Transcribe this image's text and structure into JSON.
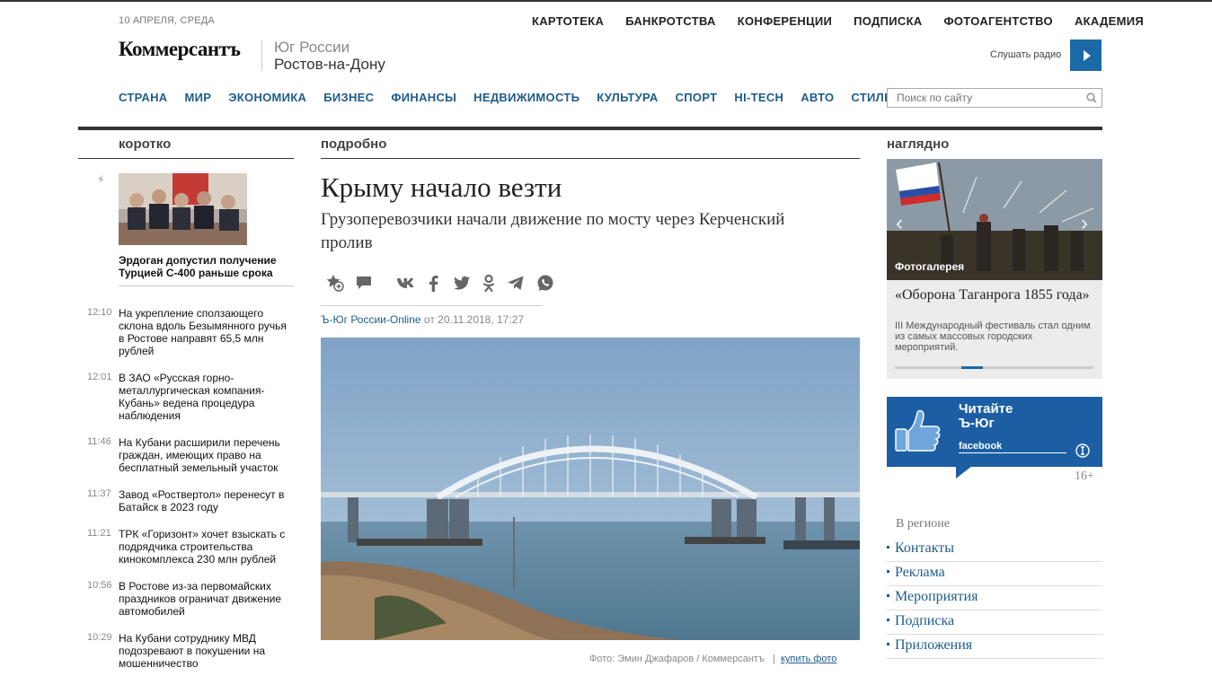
{
  "header": {
    "date": "10 АПРЕЛЯ, СРЕДА",
    "top_nav": [
      "КАРТОТЕКА",
      "БАНКРОТСТВА",
      "КОНФЕРЕНЦИИ",
      "ПОДПИСКА",
      "ФОТОАГЕНТСТВО",
      "АКАДЕМИЯ"
    ],
    "logo": "Коммерсантъ",
    "region_line1": "Юг России",
    "region_line2": "Ростов-на-Дону",
    "radio_label": "Слушать радио",
    "main_nav": [
      "СТРАНА",
      "МИР",
      "ЭКОНОМИКА",
      "БИЗНЕС",
      "ФИНАНСЫ",
      "НЕДВИЖИМОСТЬ",
      "КУЛЬТУРА",
      "СПОРТ",
      "HI-TECH",
      "АВТО",
      "СТИЛЬ"
    ],
    "search_placeholder": "Поиск по сайту"
  },
  "sections": {
    "left": "коротко",
    "center": "подробно",
    "right": "наглядно"
  },
  "short_news": {
    "lead_title": "Эрдоган допустил получение Турцией С-400 раньше срока",
    "items": [
      {
        "time": "12:10",
        "headline": "На укрепление сползающего склона вдоль Безымянного ручья в Ростове направят 65,5 млн рублей"
      },
      {
        "time": "12:01",
        "headline": "В ЗАО «Русская горно-металлургическая компания-Кубань» ведена процедура наблюдения"
      },
      {
        "time": "11:46",
        "headline": "На Кубани расширили перечень граждан, имеющих право на бесплатный земельный участок"
      },
      {
        "time": "11:37",
        "headline": "Завод «Роствертол» перенесут в Батайск в 2023 году"
      },
      {
        "time": "11:21",
        "headline": "ТРК «Горизонт» хочет взыскать с подрядчика строительства кинокомплекса 230 млн рублей"
      },
      {
        "time": "10:56",
        "headline": "В Ростове из-за первомайских праздников ограничат движение автомобилей"
      },
      {
        "time": "10:29",
        "headline": "На Кубани сотруднику МВД подозревают в покушении на мошенничество"
      }
    ]
  },
  "article": {
    "title": "Крыму начало везти",
    "subtitle": "Грузоперевозчики начали движение по мосту через Керченский пролив",
    "source": "Ъ-Юг России-Online",
    "date_prefix": "от",
    "date": "20.11.2018, 17:27",
    "photo_credit": "Фото: Эмин Джафаров / Коммерсантъ",
    "credit_sep": "|",
    "buy_photo": "купить фото",
    "share_icons": [
      "favorite-add-icon",
      "comment-icon",
      "vk-icon",
      "facebook-icon",
      "twitter-icon",
      "odnoklassniki-icon",
      "telegram-icon",
      "whatsapp-icon"
    ]
  },
  "gallery": {
    "label": "Фотогалерея",
    "title": "«Оборона Таганрога 1855 года»",
    "description": "III Международный фестиваль стал одним из самых массовых городских мероприятий.",
    "progress": 0.33
  },
  "facebook_promo": {
    "line1": "Читайте",
    "line2": "Ъ-Юг",
    "network": "facebook",
    "color": "#1b5ea4"
  },
  "age_rating": "16+",
  "region": {
    "heading": "В регионе",
    "links": [
      "Контакты",
      "Реклама",
      "Мероприятия",
      "Подписка",
      "Приложения"
    ]
  },
  "colors": {
    "link_blue": "#1e5c8c",
    "accent_blue": "#1b6aa8"
  }
}
